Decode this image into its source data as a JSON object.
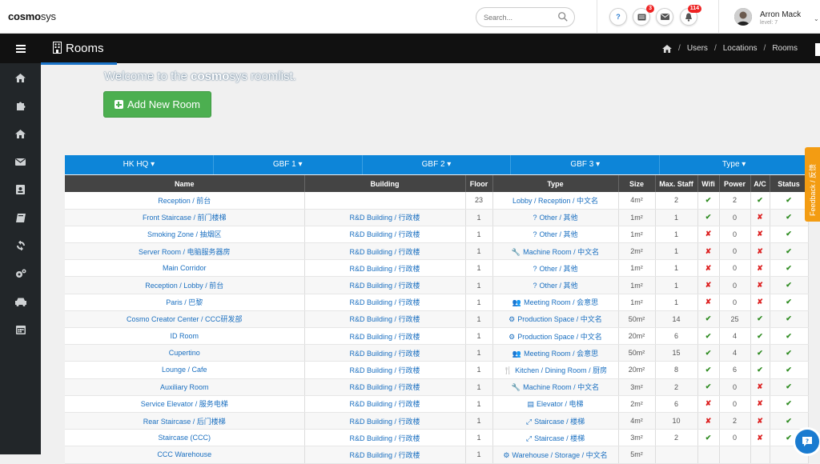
{
  "app": {
    "logo_bold": "cosmo",
    "logo_light": "sys"
  },
  "search": {
    "placeholder": "Search..."
  },
  "notifications": {
    "help": "?",
    "messages_count": "3",
    "alerts_count": "114"
  },
  "user": {
    "name": "Arron Mack",
    "level": "level: 7"
  },
  "page": {
    "title": "Rooms"
  },
  "breadcrumb": [
    "Users",
    "Locations",
    "Rooms"
  ],
  "welcome": {
    "prefix": "Welcome to the ",
    "brand_bold": "cosmo",
    "brand_light": "sys",
    "suffix": " roomlist."
  },
  "add_button": "Add New Room",
  "filters": [
    "HK HQ",
    "GBF 1",
    "GBF 2",
    "GBF 3",
    "Type"
  ],
  "columns": [
    "Name",
    "Building",
    "Floor",
    "Type",
    "Size",
    "Max. Staff",
    "Wifi",
    "Power",
    "A/C",
    "Status"
  ],
  "rows": [
    {
      "name": "Reception / 前台",
      "building": "",
      "floor": "23",
      "type": "Lobby / Reception / 中文名",
      "icon": "",
      "size": "4m²",
      "staff": "2",
      "wifi": "yes",
      "power": "2",
      "ac": "yes",
      "status": "yes"
    },
    {
      "name": "Front Staircase / 前门楼梯",
      "building": "R&D Building / 行政楼",
      "floor": "1",
      "type": "Other / 其他",
      "icon": "?",
      "size": "1m²",
      "staff": "1",
      "wifi": "yes",
      "power": "0",
      "ac": "no",
      "status": "yes"
    },
    {
      "name": "Smoking Zone / 抽烟区",
      "building": "R&D Building / 行政楼",
      "floor": "1",
      "type": "Other / 其他",
      "icon": "?",
      "size": "1m²",
      "staff": "1",
      "wifi": "no",
      "power": "0",
      "ac": "no",
      "status": "yes"
    },
    {
      "name": "Server Room / 电脑服务器房",
      "building": "R&D Building / 行政楼",
      "floor": "1",
      "type": "Machine Room / 中文名",
      "icon": "🔧",
      "size": "2m²",
      "staff": "1",
      "wifi": "no",
      "power": "0",
      "ac": "no",
      "status": "yes"
    },
    {
      "name": "Main Corridor",
      "building": "R&D Building / 行政楼",
      "floor": "1",
      "type": "Other / 其他",
      "icon": "?",
      "size": "1m²",
      "staff": "1",
      "wifi": "no",
      "power": "0",
      "ac": "no",
      "status": "yes"
    },
    {
      "name": "Reception / Lobby / 前台",
      "building": "R&D Building / 行政楼",
      "floor": "1",
      "type": "Other / 其他",
      "icon": "?",
      "size": "1m²",
      "staff": "1",
      "wifi": "no",
      "power": "0",
      "ac": "no",
      "status": "yes"
    },
    {
      "name": "Paris / 巴黎",
      "building": "R&D Building / 行政楼",
      "floor": "1",
      "type": "Meeting Room / 会意思",
      "icon": "👥",
      "size": "1m²",
      "staff": "1",
      "wifi": "no",
      "power": "0",
      "ac": "no",
      "status": "yes"
    },
    {
      "name": "Cosmo Creator Center / CCC研发部",
      "building": "R&D Building / 行政楼",
      "floor": "1",
      "type": "Production Space / 中文名",
      "icon": "⚙",
      "size": "50m²",
      "staff": "14",
      "wifi": "yes",
      "power": "25",
      "ac": "yes",
      "status": "yes"
    },
    {
      "name": "ID Room",
      "building": "R&D Building / 行政楼",
      "floor": "1",
      "type": "Production Space / 中文名",
      "icon": "⚙",
      "size": "20m²",
      "staff": "6",
      "wifi": "yes",
      "power": "4",
      "ac": "yes",
      "status": "yes"
    },
    {
      "name": "Cupertino",
      "building": "R&D Building / 行政楼",
      "floor": "1",
      "type": "Meeting Room / 会意思",
      "icon": "👥",
      "size": "50m²",
      "staff": "15",
      "wifi": "yes",
      "power": "4",
      "ac": "yes",
      "status": "yes"
    },
    {
      "name": "Lounge / Cafe",
      "building": "R&D Building / 行政楼",
      "floor": "1",
      "type": "Kitchen / Dining Room / 厨房",
      "icon": "🍴",
      "size": "20m²",
      "staff": "8",
      "wifi": "yes",
      "power": "6",
      "ac": "yes",
      "status": "yes"
    },
    {
      "name": "Auxiliary Room",
      "building": "R&D Building / 行政楼",
      "floor": "1",
      "type": "Machine Room / 中文名",
      "icon": "🔧",
      "size": "3m²",
      "staff": "2",
      "wifi": "yes",
      "power": "0",
      "ac": "no",
      "status": "yes"
    },
    {
      "name": "Service Elevator / 服务电梯",
      "building": "R&D Building / 行政楼",
      "floor": "1",
      "type": "Elevator / 电梯",
      "icon": "▤",
      "size": "2m²",
      "staff": "6",
      "wifi": "no",
      "power": "0",
      "ac": "no",
      "status": "yes"
    },
    {
      "name": "Rear Staircase / 后门楼梯",
      "building": "R&D Building / 行政楼",
      "floor": "1",
      "type": "Staircase / 楼梯",
      "icon": "⤢",
      "size": "4m²",
      "staff": "10",
      "wifi": "no",
      "power": "2",
      "ac": "no",
      "status": "yes"
    },
    {
      "name": "Staircase (CCC)",
      "building": "R&D Building / 行政楼",
      "floor": "1",
      "type": "Staircase / 楼梯",
      "icon": "⤢",
      "size": "3m²",
      "staff": "2",
      "wifi": "yes",
      "power": "0",
      "ac": "no",
      "status": "yes"
    },
    {
      "name": "CCC Warehouse",
      "building": "R&D Building / 行政楼",
      "floor": "1",
      "type": "Warehouse / Storage / 中文名",
      "icon": "⚙",
      "size": "5m²",
      "staff": "",
      "wifi": "",
      "power": "",
      "ac": "",
      "status": ""
    }
  ],
  "feedback": {
    "label": "Feedback / 反馈"
  },
  "colors": {
    "filter_bar": "#0d85d8",
    "add_button": "#4caf50",
    "feedback": "#f39c12",
    "sidebar": "#222629",
    "header": "#111111"
  }
}
